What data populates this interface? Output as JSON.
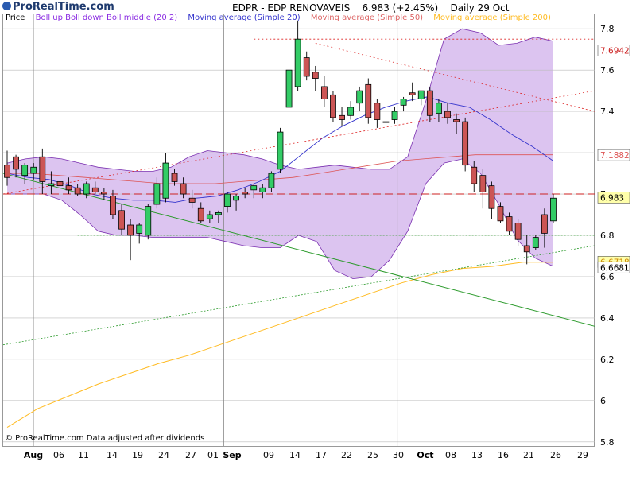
{
  "site": "ProRealTime.com",
  "header": {
    "symbol": "EDPR - EDP RENOVAVEIS",
    "last": "6.983 (+2.45%)",
    "period": "Daily 29 Oct"
  },
  "legend": {
    "price": "Price",
    "boll": "Boll up Boll down Boll middle (20 2)",
    "sma20": "Moving average (Simple 20)",
    "sma50": "Moving average (Simple 50)",
    "sma200": "Moving average (Simple 200)"
  },
  "footer": "© ProRealTime.com Data adjusted after dividends",
  "colors": {
    "up": "#33cc66",
    "down": "#cc5555",
    "band": "#dcc4f0",
    "bandEdge": "#7a2fb0",
    "sma20": "#3333cc",
    "sma50": "#dd5555",
    "sma200": "#ffbb22",
    "trendGreen": "#2b9a2b",
    "trendRed": "#dd2222",
    "grid": "#bbbbbb"
  },
  "chart_data": {
    "type": "candlestick",
    "y_ticks": [
      5.8,
      6,
      6.2,
      6.4,
      6.6,
      6.8,
      7,
      7.2,
      7.4,
      7.6,
      7.8
    ],
    "ylim": [
      5.78,
      7.87
    ],
    "x_ticks": [
      "Aug",
      "06",
      "11",
      "14",
      "19",
      "24",
      "27",
      "01",
      "Sep",
      "09",
      "14",
      "17",
      "22",
      "25",
      "30",
      "Oct",
      "08",
      "13",
      "16",
      "21",
      "26",
      "29"
    ],
    "value_labels": [
      "7.6942",
      "7.1882",
      "6.983",
      "6.6718",
      "6.6681"
    ],
    "candles": [
      [
        7.14,
        7.21,
        7.04,
        7.08
      ],
      [
        7.18,
        7.19,
        7.08,
        7.12
      ],
      [
        7.09,
        7.15,
        7.05,
        7.14
      ],
      [
        7.1,
        7.15,
        7.07,
        7.13
      ],
      [
        7.18,
        7.22,
        7.0,
        7.06
      ],
      [
        7.04,
        7.11,
        7.0,
        7.05
      ],
      [
        7.06,
        7.09,
        7.03,
        7.04
      ],
      [
        7.04,
        7.08,
        7.0,
        7.02
      ],
      [
        7.03,
        7.05,
        6.99,
        7.0
      ],
      [
        7.0,
        7.06,
        6.98,
        7.05
      ],
      [
        7.03,
        7.06,
        7.0,
        7.01
      ],
      [
        7.01,
        7.03,
        6.97,
        7.0
      ],
      [
        6.99,
        7.02,
        6.88,
        6.9
      ],
      [
        6.92,
        6.95,
        6.8,
        6.83
      ],
      [
        6.85,
        6.88,
        6.68,
        6.8
      ],
      [
        6.81,
        6.86,
        6.76,
        6.85
      ],
      [
        6.8,
        6.95,
        6.78,
        6.94
      ],
      [
        6.95,
        7.08,
        6.93,
        7.05
      ],
      [
        6.98,
        7.2,
        6.96,
        7.15
      ],
      [
        7.1,
        7.12,
        7.04,
        7.06
      ],
      [
        7.05,
        7.08,
        6.98,
        7.0
      ],
      [
        6.98,
        7.02,
        6.93,
        6.96
      ],
      [
        6.93,
        6.96,
        6.86,
        6.87
      ],
      [
        6.88,
        6.92,
        6.86,
        6.9
      ],
      [
        6.9,
        6.92,
        6.86,
        6.91
      ],
      [
        6.94,
        7.01,
        6.91,
        7.0
      ],
      [
        6.97,
        7.0,
        6.92,
        6.99
      ],
      [
        7.01,
        7.03,
        6.98,
        7.0
      ],
      [
        7.02,
        7.05,
        6.98,
        7.04
      ],
      [
        7.01,
        7.05,
        6.98,
        7.03
      ],
      [
        7.03,
        7.11,
        7.01,
        7.1
      ],
      [
        7.12,
        7.32,
        7.1,
        7.3
      ],
      [
        7.42,
        7.62,
        7.38,
        7.6
      ],
      [
        7.52,
        7.84,
        7.5,
        7.75
      ],
      [
        7.66,
        7.69,
        7.55,
        7.57
      ],
      [
        7.59,
        7.62,
        7.5,
        7.56
      ],
      [
        7.52,
        7.57,
        7.42,
        7.46
      ],
      [
        7.48,
        7.5,
        7.35,
        7.37
      ],
      [
        7.38,
        7.42,
        7.33,
        7.36
      ],
      [
        7.38,
        7.45,
        7.36,
        7.42
      ],
      [
        7.44,
        7.52,
        7.4,
        7.5
      ],
      [
        7.53,
        7.56,
        7.34,
        7.37
      ],
      [
        7.44,
        7.46,
        7.32,
        7.36
      ],
      [
        7.35,
        7.38,
        7.32,
        7.35
      ],
      [
        7.36,
        7.42,
        7.34,
        7.4
      ],
      [
        7.43,
        7.47,
        7.4,
        7.46
      ],
      [
        7.49,
        7.54,
        7.45,
        7.48
      ],
      [
        7.46,
        7.5,
        7.43,
        7.5
      ],
      [
        7.5,
        7.52,
        7.35,
        7.38
      ],
      [
        7.39,
        7.46,
        7.35,
        7.44
      ],
      [
        7.4,
        7.44,
        7.34,
        7.37
      ],
      [
        7.36,
        7.39,
        7.29,
        7.35
      ],
      [
        7.35,
        7.37,
        7.11,
        7.14
      ],
      [
        7.13,
        7.16,
        7.01,
        7.05
      ],
      [
        7.09,
        7.12,
        6.93,
        7.01
      ],
      [
        7.04,
        7.06,
        6.88,
        6.93
      ],
      [
        6.94,
        6.96,
        6.86,
        6.87
      ],
      [
        6.89,
        6.91,
        6.8,
        6.82
      ],
      [
        6.86,
        6.88,
        6.75,
        6.78
      ],
      [
        6.75,
        6.8,
        6.66,
        6.72
      ],
      [
        6.74,
        6.8,
        6.73,
        6.79
      ],
      [
        6.9,
        6.93,
        6.74,
        6.81
      ],
      [
        6.87,
        7.0,
        6.86,
        6.98
      ]
    ],
    "bollinger_upper": [
      7.15,
      7.17,
      7.18,
      7.17,
      7.15,
      7.13,
      7.12,
      7.11,
      7.11,
      7.13,
      7.18,
      7.21,
      7.2,
      7.19,
      7.17,
      7.14,
      7.12,
      7.13,
      7.14,
      7.13,
      7.12,
      7.12,
      7.18,
      7.45,
      7.75,
      7.8,
      7.78,
      7.72,
      7.73,
      7.76,
      7.74
    ],
    "bollinger_lower": [
      7.0,
      7.0,
      7.0,
      6.97,
      6.9,
      6.82,
      6.8,
      6.8,
      6.79,
      6.79,
      6.79,
      6.79,
      6.77,
      6.75,
      6.74,
      6.74,
      6.8,
      6.77,
      6.63,
      6.59,
      6.6,
      6.68,
      6.82,
      7.05,
      7.15,
      7.17,
      7.1,
      6.95,
      6.78,
      6.69,
      6.65
    ],
    "sma20": [
      7.1,
      7.08,
      7.07,
      7.04,
      7.0,
      6.98,
      6.97,
      6.97,
      6.96,
      6.98,
      6.99,
      7.02,
      7.06,
      7.11,
      7.19,
      7.27,
      7.33,
      7.38,
      7.42,
      7.45,
      7.47,
      7.44,
      7.42,
      7.36,
      7.29,
      7.23,
      7.16
    ],
    "sma50": [
      7.1,
      7.1,
      7.09,
      7.08,
      7.07,
      7.06,
      7.05,
      7.05,
      7.05,
      7.06,
      7.07,
      7.08,
      7.1,
      7.12,
      7.14,
      7.16,
      7.17,
      7.18,
      7.19,
      7.19,
      7.19,
      7.19
    ],
    "sma200": [
      5.87,
      5.96,
      6.02,
      6.08,
      6.13,
      6.18,
      6.22,
      6.27,
      6.32,
      6.37,
      6.42,
      6.47,
      6.52,
      6.57,
      6.61,
      6.64,
      6.65,
      6.67,
      6.67
    ],
    "resistance": 7.75,
    "support": 6.8,
    "level": 7.0
  }
}
